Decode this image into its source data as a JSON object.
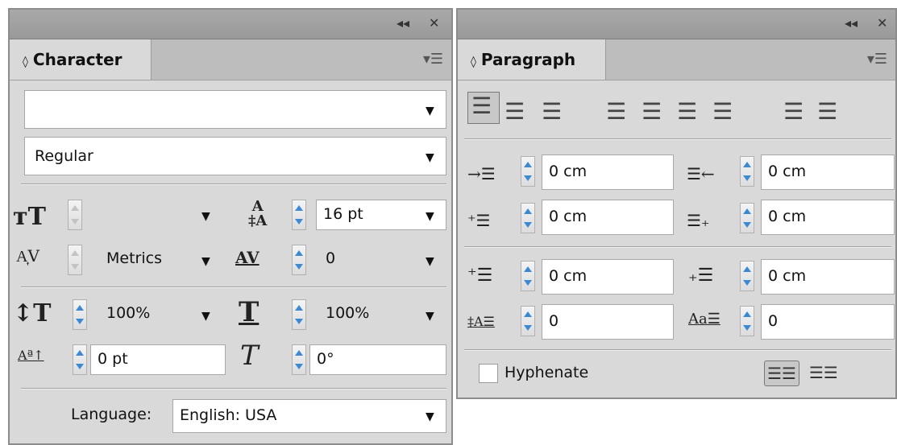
{
  "character": {
    "tab_label": "Character",
    "font_family_value": "",
    "font_style_value": "Regular",
    "font_size_value": "",
    "leading_value": "16 pt",
    "kerning_value": "Metrics",
    "tracking_value": "0",
    "vertical_scale_value": "100%",
    "horizontal_scale_value": "100%",
    "baseline_shift_value": "0 pt",
    "skew_value": "0°",
    "language_label": "Language:",
    "language_value": "English: USA"
  },
  "paragraph": {
    "tab_label": "Paragraph",
    "left_indent_value": "0 cm",
    "right_indent_value": "0 cm",
    "first_line_indent_value": "0 cm",
    "last_line_indent_value": "0 cm",
    "space_before_value": "0 cm",
    "space_after_value": "0 cm",
    "drop_cap_lines_value": "0",
    "drop_cap_chars_value": "0",
    "hyphenate_label": "Hyphenate",
    "hyphenate_checked": false
  },
  "colors": {
    "panel_bg": "#d9d9d9",
    "titlebar": "#a3a3a3",
    "spinner_arrow": "#3a8ad4"
  }
}
